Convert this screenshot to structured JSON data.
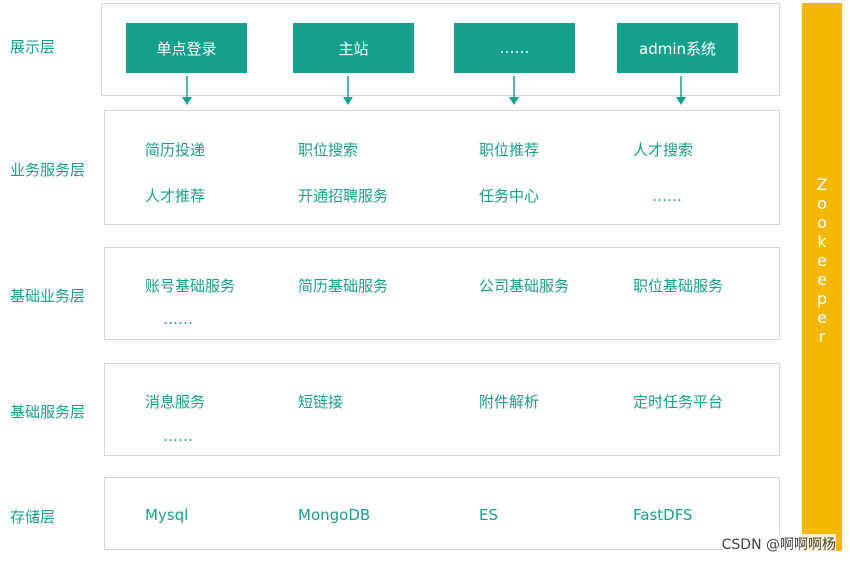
{
  "layers": {
    "presentation": {
      "label": "展示层",
      "items": [
        "单点登录",
        "主站",
        "……",
        "admin系统"
      ]
    },
    "business": {
      "label": "业务服务层",
      "row1": [
        "简历投递",
        "职位搜索",
        "职位推荐",
        "人才搜索"
      ],
      "row2": [
        "人才推荐",
        "开通招聘服务",
        "任务中心",
        "……"
      ]
    },
    "base_business": {
      "label": "基础业务层",
      "row1": [
        "账号基础服务",
        "简历基础服务",
        "公司基础服务",
        "职位基础服务"
      ],
      "row2": [
        "……"
      ]
    },
    "base_service": {
      "label": "基础服务层",
      "row1": [
        "消息服务",
        "短链接",
        "附件解析",
        "定时任务平台"
      ],
      "row2": [
        "……"
      ]
    },
    "storage": {
      "label": "存储层",
      "items": [
        "Mysql",
        "MongoDB",
        "ES",
        "FastDFS"
      ]
    }
  },
  "sidebar": {
    "label": "Zookeeper"
  },
  "watermark": "CSDN @啊啊啊杨",
  "colors": {
    "accent": "#14a08a",
    "sidebar": "#f5b800",
    "border": "#d6d6d6"
  }
}
